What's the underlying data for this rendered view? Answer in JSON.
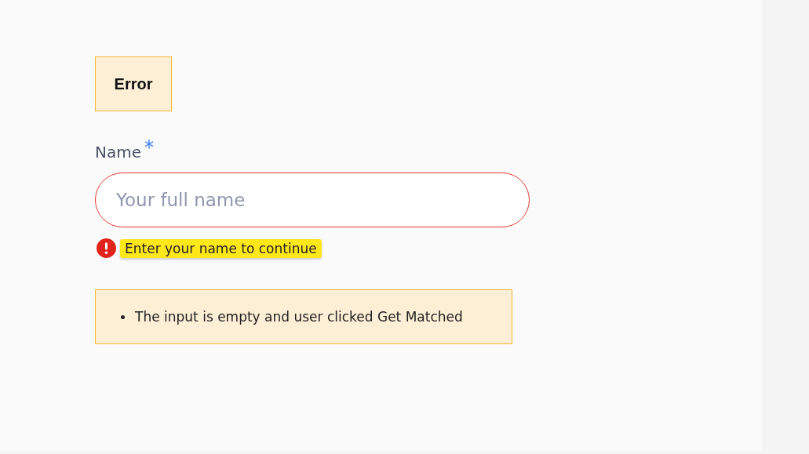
{
  "badge": {
    "label": "Error"
  },
  "field": {
    "label": "Name",
    "required_mark": "*",
    "placeholder": "Your full name",
    "invalid": true,
    "error_message": "Enter your name to continue"
  },
  "notes": [
    "The input is empty and user clicked Get Matched"
  ]
}
